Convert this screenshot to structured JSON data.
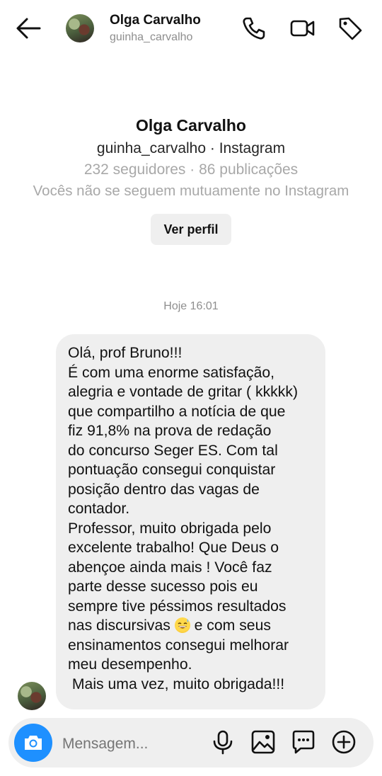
{
  "header": {
    "name": "Olga Carvalho",
    "username": "guinha_carvalho",
    "icons": [
      "back-arrow-icon",
      "phone-icon",
      "video-icon",
      "tag-icon"
    ]
  },
  "profile": {
    "name": "Olga Carvalho",
    "username_line": "guinha_carvalho · Instagram",
    "stats": "232 seguidores · 86 publicações",
    "mutual": "Vocês não se seguem mutuamente no Instagram",
    "view_profile_label": "Ver perfil"
  },
  "conversation": {
    "timestamp": "Hoje 16:01",
    "message_before_emoji": "Olá, prof Bruno!!!\nÉ com uma enorme satisfação,\nalegria e vontade de gritar ( kkkkk)\nque compartilho a notícia de que\nfiz 91,8% na prova de redação\ndo concurso Seger ES. Com tal\npontuação consegui conquistar\nposição dentro das vagas de\ncontador.\nProfessor, muito obrigada pelo\nexcelente trabalho! Que Deus o\nabençoe ainda mais ! Você faz\nparte desse sucesso pois eu\nsempre tive péssimos resultados\nnas discursivas ",
    "emoji": "grinning-sweat-emoji",
    "message_after_emoji": " e com seus\nensinamentos consegui melhorar\nmeu desempenho.\n Mais uma vez, muito obrigada!!!"
  },
  "composer": {
    "placeholder": "Mensagem...",
    "icons": [
      "camera-icon",
      "microphone-icon",
      "gallery-icon",
      "sticker-icon",
      "plus-icon"
    ],
    "camera_color": "#1e90ff"
  }
}
